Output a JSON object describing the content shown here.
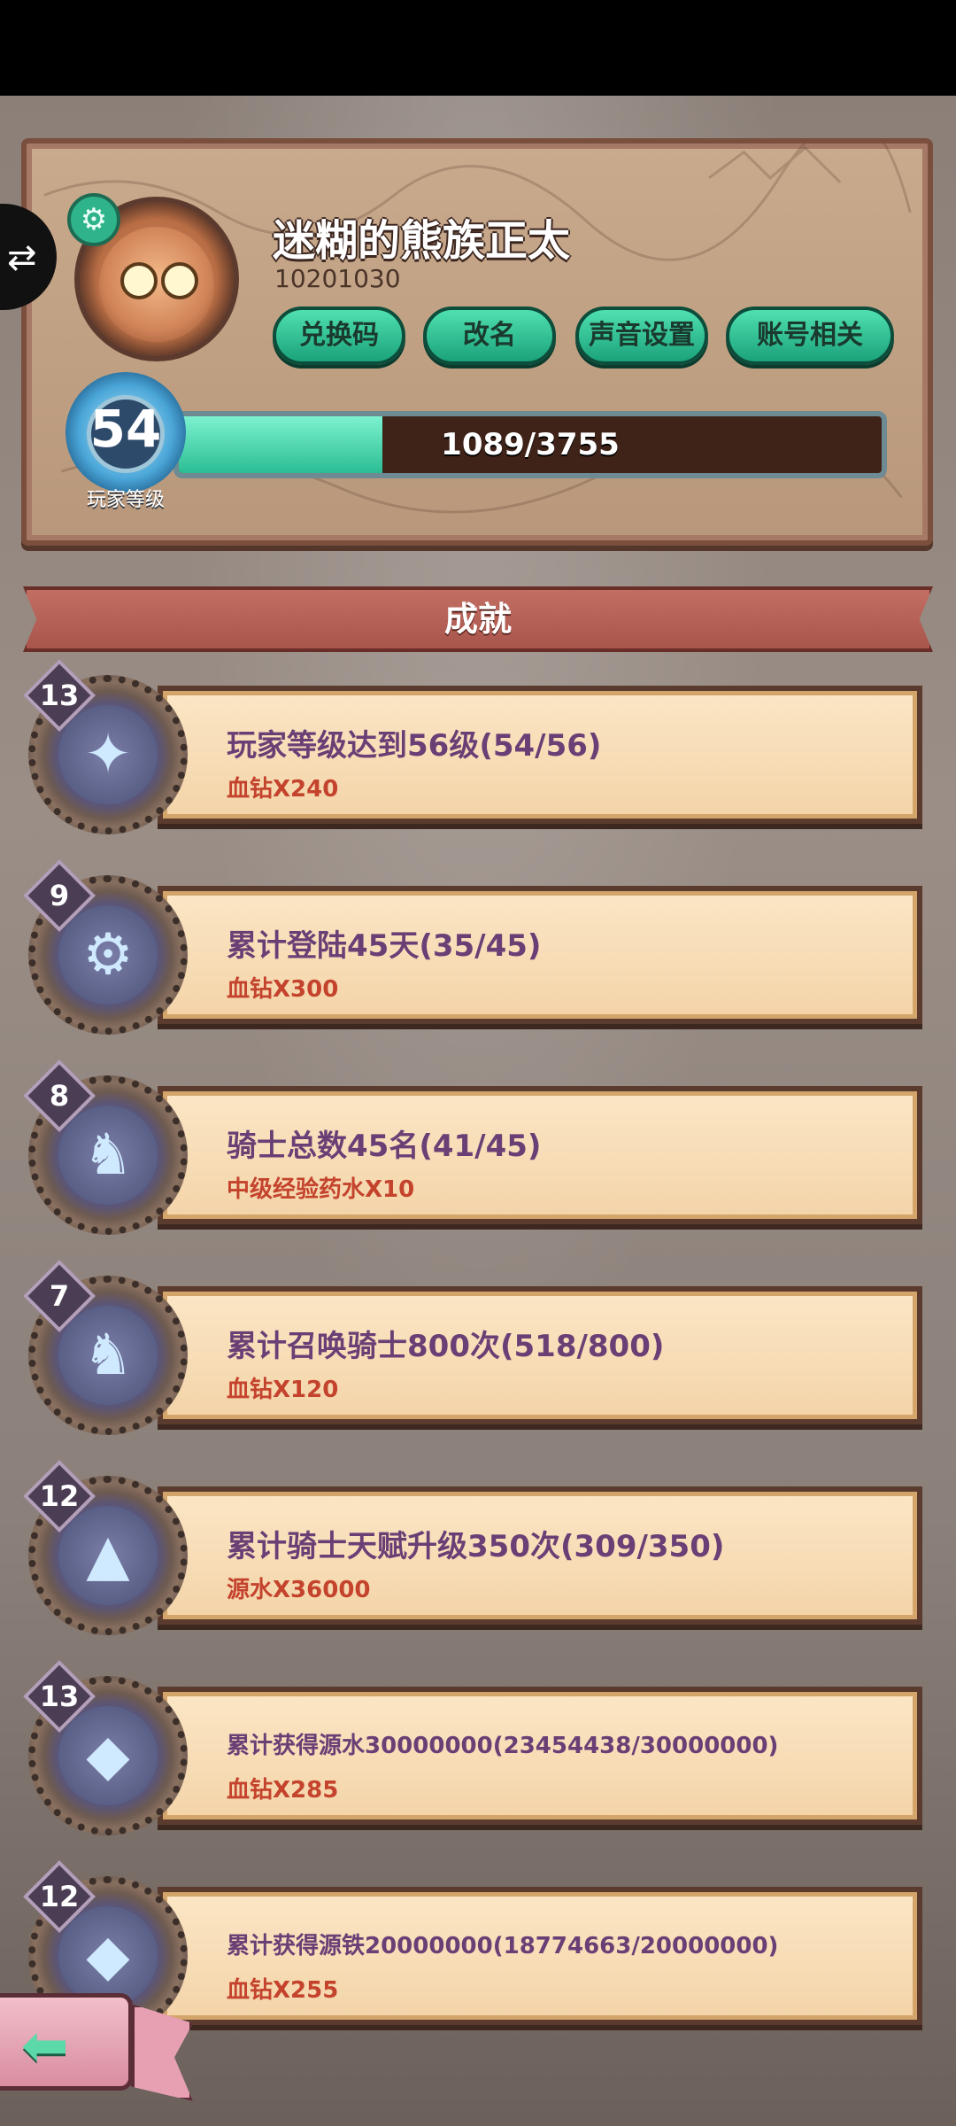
{
  "side_tab": {
    "icon": "swap-icon"
  },
  "profile": {
    "name": "迷糊的熊族正太",
    "id": "10201030",
    "buttons": {
      "redeem": "兑换码",
      "rename": "改名",
      "sound": "声音设置",
      "account": "账号相关"
    },
    "level": {
      "value": "54",
      "label": "玩家等级"
    },
    "xp": {
      "text": "1089/3755",
      "current": 1089,
      "max": 3755
    }
  },
  "section_title": "成就",
  "achievements": [
    {
      "count": "13",
      "title": "玩家等级达到56级(54/56)",
      "reward": "血钻X240",
      "icon": "blue-flame-icon"
    },
    {
      "count": "9",
      "title": "累计登陆45天(35/45)",
      "reward": "血钻X300",
      "icon": "gear-helmet-icon"
    },
    {
      "count": "8",
      "title": "骑士总数45名(41/45)",
      "reward": "中级经验药水X10",
      "icon": "knights-icon"
    },
    {
      "count": "7",
      "title": "累计召唤骑士800次(518/800)",
      "reward": "血钻X120",
      "icon": "knights-summon-icon"
    },
    {
      "count": "12",
      "title": "累计骑士天赋升级350次(309/350)",
      "reward": "源水X36000",
      "icon": "knight-talent-icon"
    },
    {
      "count": "13",
      "title": "累计获得源水30000000(23454438/30000000)",
      "reward": "血钻X285",
      "icon": "source-water-icon"
    },
    {
      "count": "12",
      "title": "累计获得源铁20000000(18774663/20000000)",
      "reward": "血钻X255",
      "icon": "source-iron-icon"
    }
  ],
  "back_button": {
    "icon": "back-arrow-icon"
  }
}
